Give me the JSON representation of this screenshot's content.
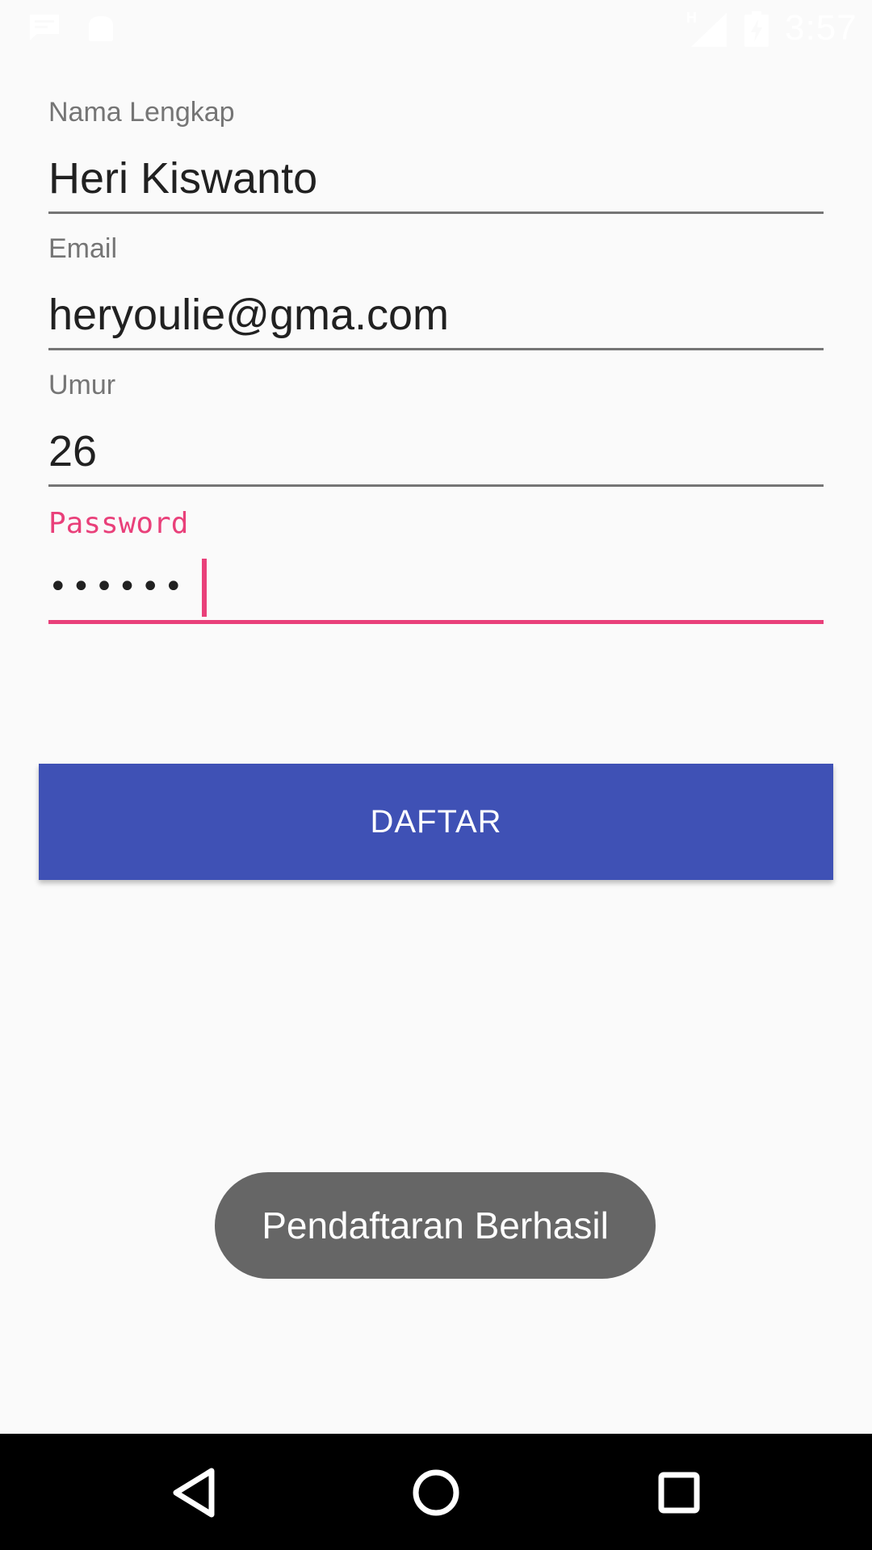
{
  "status_bar": {
    "time": "3:57",
    "network_type": "H",
    "icons": [
      "message-icon",
      "android-icon",
      "signal-icon",
      "battery-charging-icon"
    ]
  },
  "form": {
    "name_label": "Nama Lengkap",
    "name_value": "Heri Kiswanto",
    "email_label": "Email",
    "email_value": "heryoulie@gma.com",
    "age_label": "Umur",
    "age_value": "26",
    "password_label": "Password",
    "password_value": "••••••"
  },
  "button": {
    "label": "DAFTAR"
  },
  "toast": {
    "message": "Pendaftaran Berhasil"
  },
  "nav": {
    "icons": [
      "back-icon",
      "home-icon",
      "recents-icon"
    ]
  },
  "colors": {
    "primary": "#3f51b5",
    "accent": "#e9407a",
    "background": "#fafafa",
    "toast": "#666666"
  }
}
